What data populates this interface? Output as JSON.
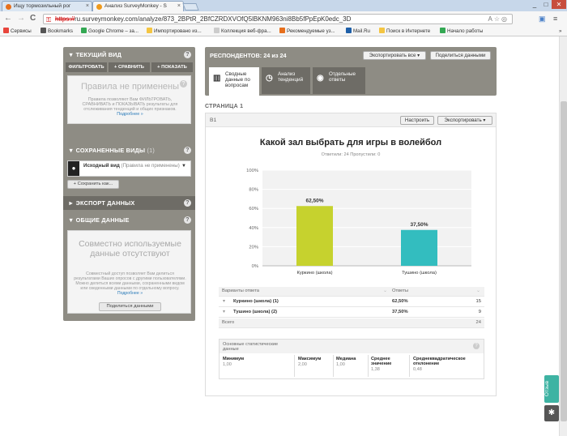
{
  "browser": {
    "tabs": [
      {
        "label": "Ищу тормозильный рог",
        "icon_color": "#e76f1c"
      },
      {
        "label": "Анализ SurveyMonkey - S",
        "icon_color": "#ef9a1c"
      }
    ],
    "window_controls": [
      "_",
      "□",
      "✕"
    ],
    "nav": {
      "back": "←",
      "forward": "→",
      "reload": "C"
    },
    "url": {
      "scheme": "https://",
      "rest": "ru.surveymonkey.com/analyze/873_2BPtR_2BfCZRDXVOfQ5lBKNM963ni8Bb5fPpEpK0edc_3D"
    },
    "omnibox_icons": [
      "A",
      "☆",
      "◎",
      "▤"
    ],
    "toolbar_icons": [
      "▣",
      "≡"
    ],
    "bookmarks": [
      {
        "label": "Сервисы",
        "icon_color": "#e8453c"
      },
      {
        "label": "Bookmarks",
        "icon_color": "#555555"
      },
      {
        "label": "Google Chrome – за...",
        "icon_color": "#34a853"
      },
      {
        "label": "Импортировано из...",
        "icon_color": "#f4c542"
      },
      {
        "label": "Коллекция веб-фра...",
        "icon_color": "#cccccc"
      },
      {
        "label": "Рекомендуемые уз...",
        "icon_color": "#e76f1c"
      },
      {
        "label": "Mail.Ru",
        "icon_color": "#1e5fa8"
      },
      {
        "label": "Поиск в Интернете",
        "icon_color": "#f4c542"
      },
      {
        "label": "Начало работы",
        "icon_color": "#34a853"
      }
    ],
    "bookmarks_more": "»"
  },
  "sidebar": {
    "current_view": {
      "title": "▼ ТЕКУЩИЙ ВИД",
      "filter_buttons": [
        "ФИЛЬТРОВАТЬ",
        "+ СРАВНИТЬ",
        "+ ПОКАЗАТЬ"
      ],
      "rules_title": "Правила не применены",
      "rules_desc": "Правила позволяют Вам ФИЛЬТРОВАТЬ, СРАВНИВАТЬ и ПОКАЗЫВАТЬ результаты для отслеживания тенденций и общих признаков.",
      "more_link": "Подробнее »"
    },
    "saved_views": {
      "title": "▼ СОХРАНЕННЫЕ ВИДЫ",
      "count": "(1)",
      "item_name": "Исходный вид",
      "item_note": "(Правила не применены)",
      "save_button": "+ Сохранить как..."
    },
    "export": {
      "title": "► ЭКСПОРТ ДАННЫХ"
    },
    "shared": {
      "title": "▼ ОБЩИЕ ДАННЫЕ",
      "panel_title": "Совместно используемые данные отсутствуют",
      "desc": "Совместный доступ позволяет Вам делиться результатами Ваших опросов с другими пользователями. Можно делиться всеми данными, сохраненными видом или сведенными данными по отдельному вопросу.",
      "more_link": "Подробнее »",
      "share_button": "Поделиться данными"
    }
  },
  "main": {
    "respondents": "РЕСПОНДЕНТОВ: 24 из 24",
    "export_all": "Экспортировать все ▾",
    "share_data": "Поделиться данными",
    "view_tabs": [
      {
        "icon": "▥",
        "label": "Сводные данные по вопросам"
      },
      {
        "icon": "◷",
        "label": "Анализ тенденций"
      },
      {
        "icon": "◉",
        "label": "Отдельные ответы"
      }
    ],
    "page_label": "СТРАНИЦА 1",
    "question": {
      "id": "В1",
      "configure": "Настроить",
      "export": "Экспортировать ▾",
      "title": "Какой зал выбрать для игры в волейбол",
      "stats": "Ответили: 24   Пропустили: 0"
    },
    "table": {
      "headers": [
        "Варианты ответа",
        "Ответы"
      ],
      "rows": [
        {
          "label": "Куркино (школа) (1)",
          "percent": "62,50%",
          "count": "15"
        },
        {
          "label": "Тушино (школа) (2)",
          "percent": "37,50%",
          "count": "9"
        }
      ],
      "total_label": "Всего",
      "total": "24"
    },
    "stats_box": {
      "title": "Основные статистические данные",
      "columns": [
        {
          "label": "Минимум",
          "value": "1,00"
        },
        {
          "label": "Максимум",
          "value": "2,00"
        },
        {
          "label": "Медиана",
          "value": "1,00"
        },
        {
          "label": "Среднее значение",
          "value": "1,38"
        },
        {
          "label": "Среднеквадратическое отклонение",
          "value": "0,48"
        }
      ]
    }
  },
  "chart_data": {
    "type": "bar",
    "title": "Какой зал выбрать для игры в волейбол",
    "categories": [
      "Куркино (школа)",
      "Тушино (школа)"
    ],
    "values": [
      62.5,
      37.5
    ],
    "value_labels": [
      "62,50%",
      "37,50%"
    ],
    "colors": [
      "#c6d22e",
      "#33bdbf"
    ],
    "ylim": [
      0,
      100
    ],
    "yticks": [
      "0%",
      "20%",
      "40%",
      "60%",
      "80%",
      "100%"
    ],
    "grid": true,
    "plot_bg": "#f2f2f2"
  },
  "widgets": {
    "feedback": "Отзыв",
    "bug_icon": "✱"
  }
}
